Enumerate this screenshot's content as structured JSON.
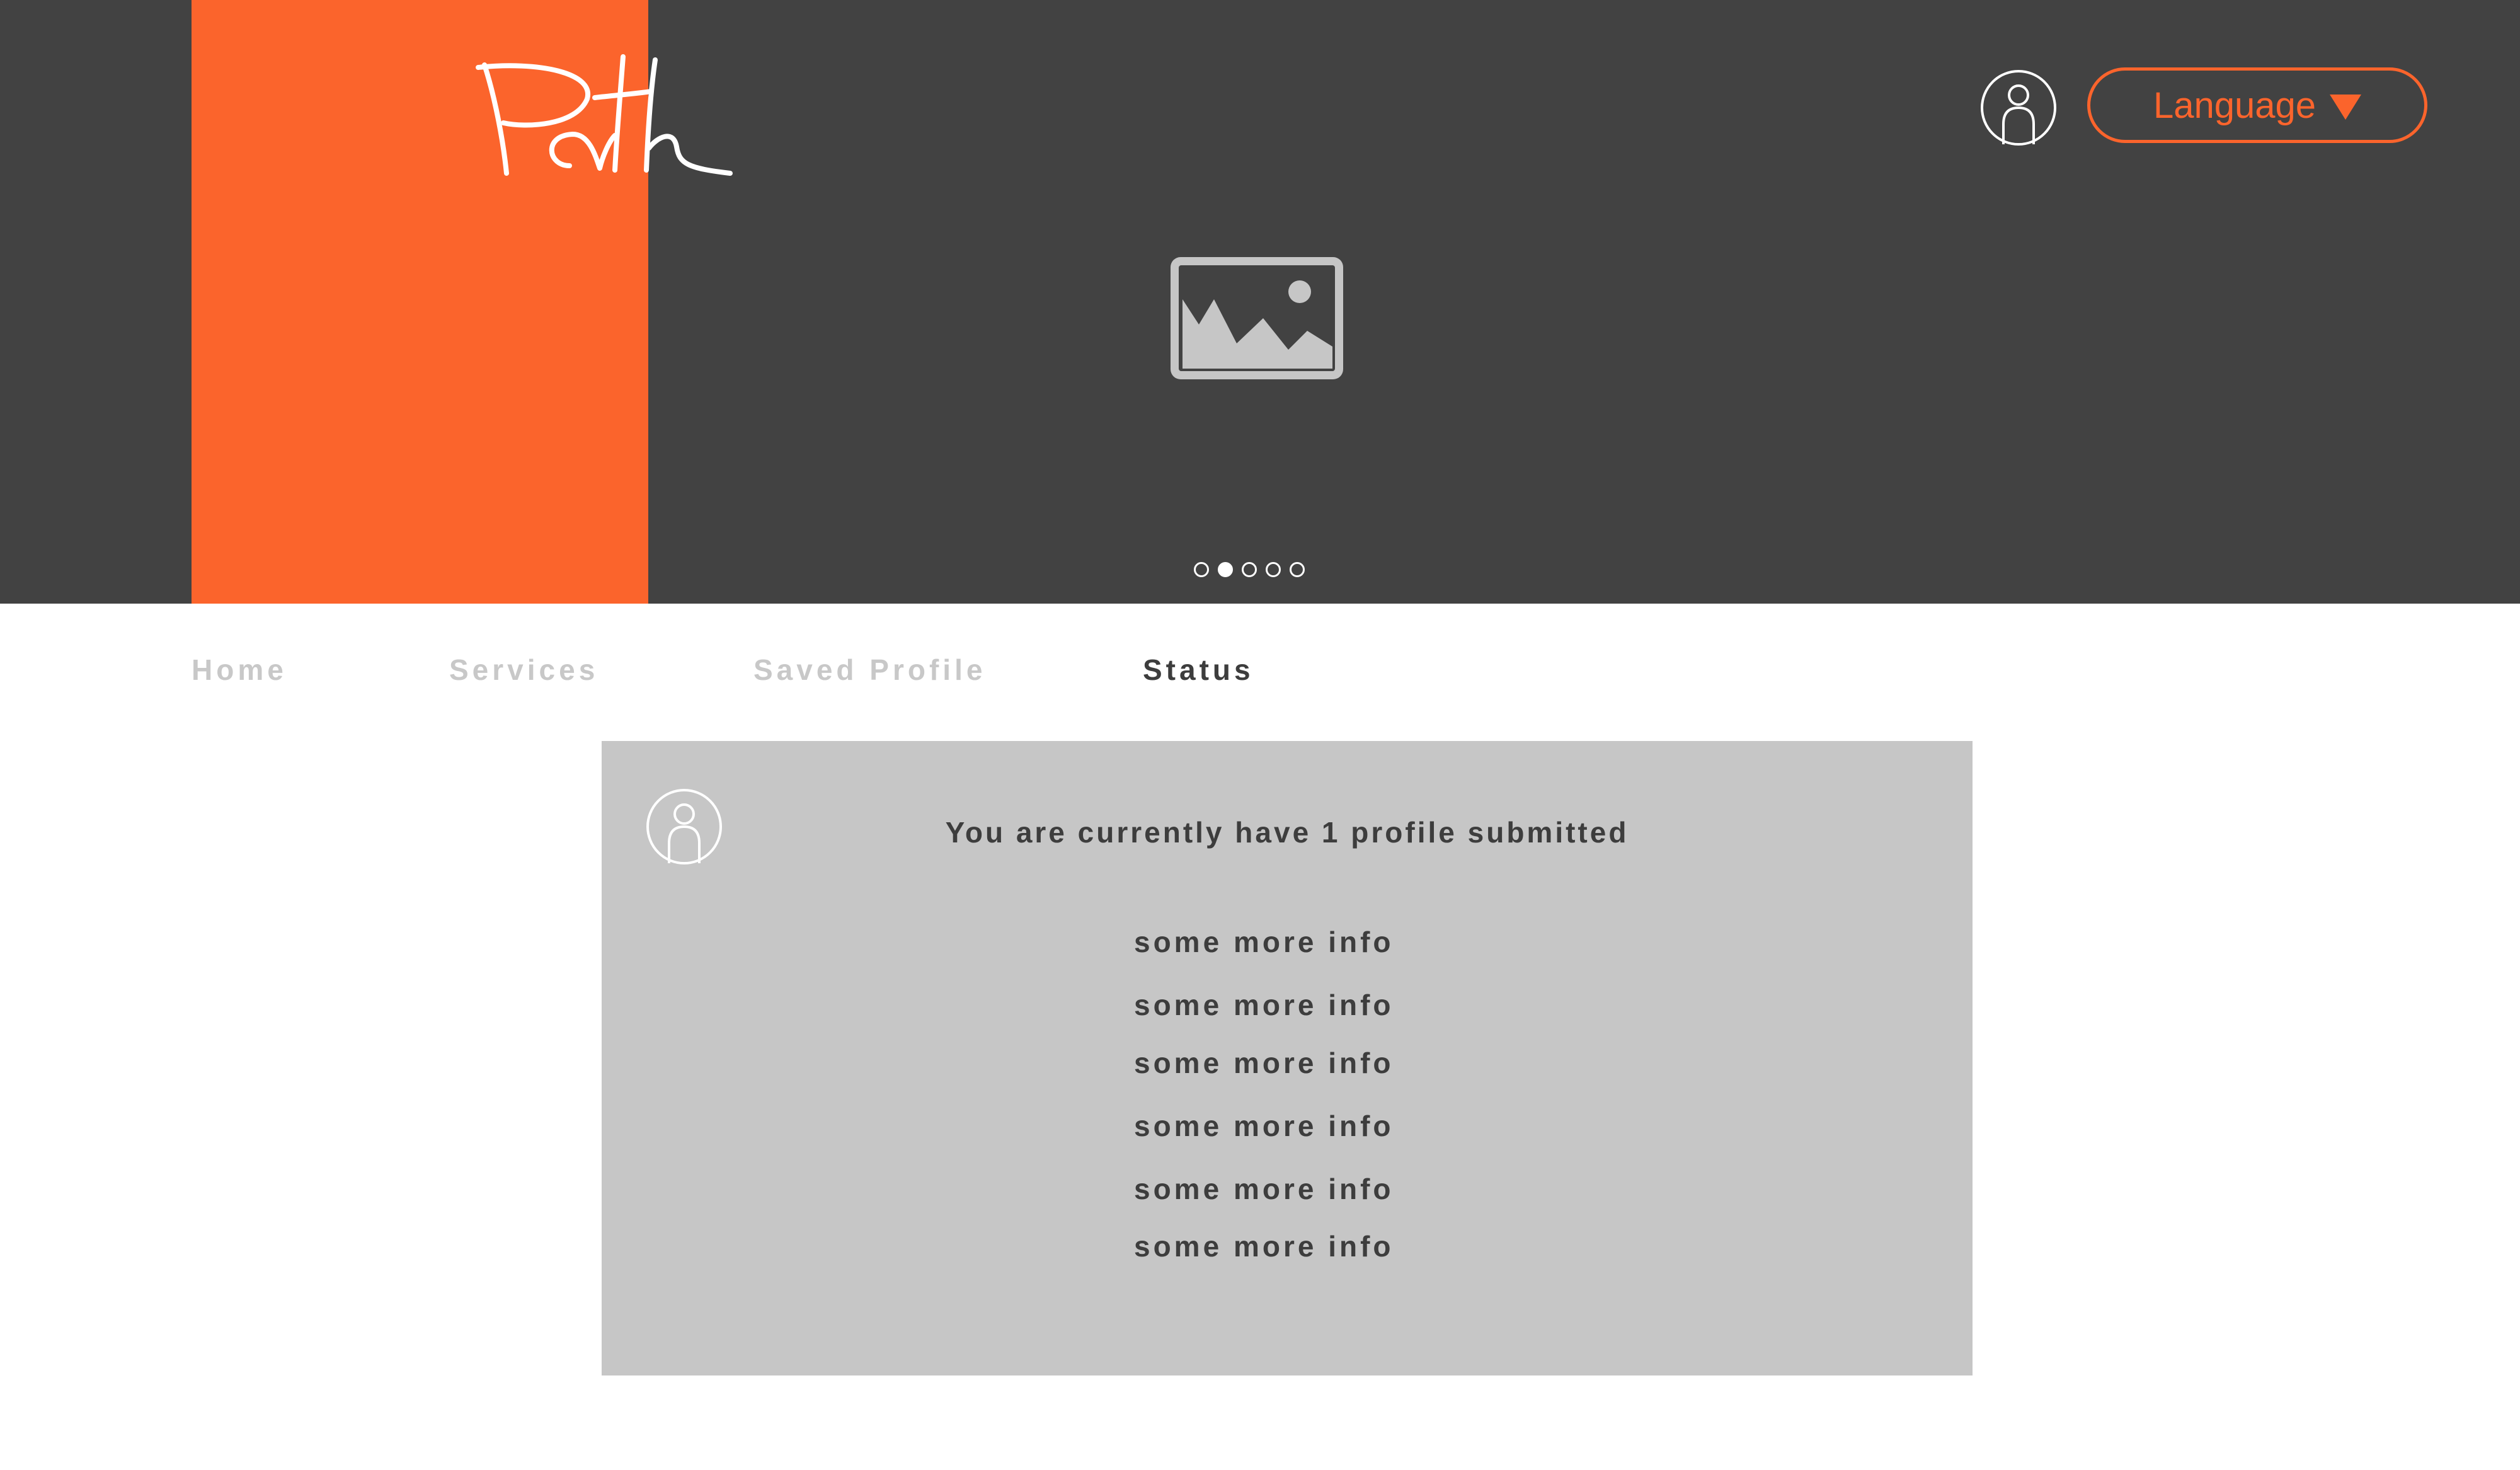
{
  "header": {
    "logo_text": "Path",
    "brand_color": "#fb642c",
    "background_color": "#424242",
    "hero_image_icon": "image-placeholder-icon",
    "user_icon": "user-icon",
    "language": {
      "label": "Language",
      "icon": "triangle-down-icon"
    },
    "carousel": {
      "total": 5,
      "active_index": 1
    }
  },
  "nav": {
    "items": [
      {
        "label": "Home",
        "active": false
      },
      {
        "label": "Services",
        "active": false
      },
      {
        "label": "Saved Profile",
        "active": false
      },
      {
        "label": "Status",
        "active": true
      }
    ]
  },
  "status": {
    "avatar_icon": "user-icon",
    "title": "You are currently have 1 profile submitted",
    "info": [
      "some more info",
      "some more info",
      "some more info",
      "some more info",
      "some more info",
      "some more info"
    ]
  }
}
